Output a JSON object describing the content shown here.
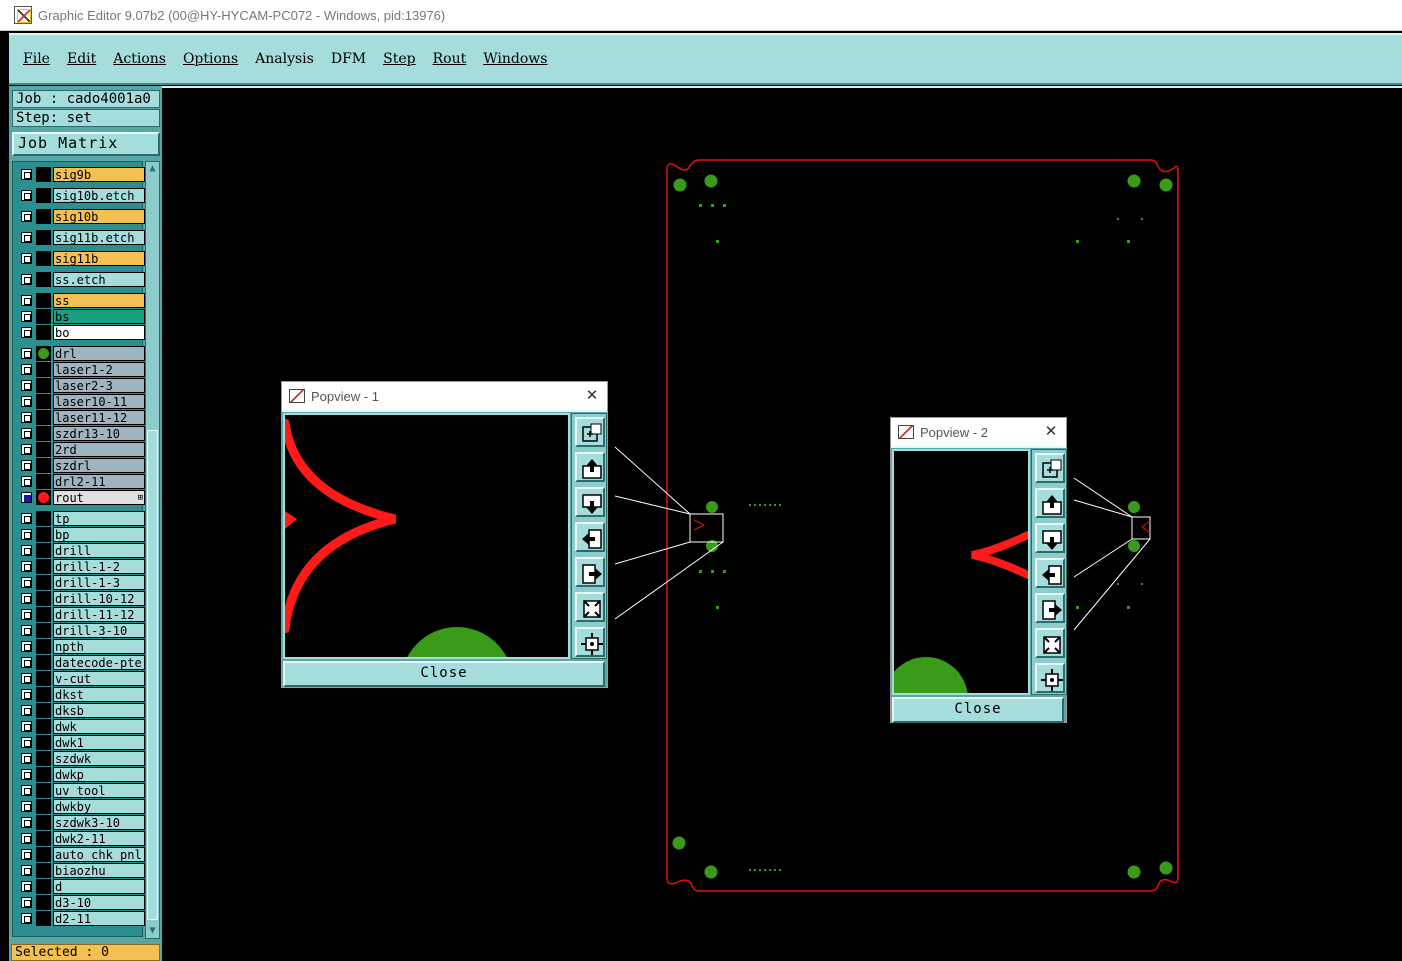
{
  "window": {
    "title": "Graphic Editor 9.07b2 (00@HY-HYCAM-PC072 - Windows, pid:13976)"
  },
  "menu": [
    {
      "label": "File",
      "underline": true
    },
    {
      "label": "Edit",
      "underline": true
    },
    {
      "label": "Actions",
      "underline": true
    },
    {
      "label": "Options",
      "underline": true
    },
    {
      "label": "Analysis",
      "underline": false
    },
    {
      "label": "DFM",
      "underline": false
    },
    {
      "label": "Step",
      "underline": true
    },
    {
      "label": "Rout",
      "underline": true
    },
    {
      "label": "Windows",
      "underline": true
    }
  ],
  "panel": {
    "job": "Job : cado4001a0",
    "step": "Step: set",
    "job_matrix": "Job Matrix ...",
    "selected": "Selected : 0"
  },
  "layers": [
    {
      "name": "sig9b",
      "color": "#f5c052"
    },
    {
      "name": "sig10b.etch",
      "color": "#a5dcdc"
    },
    {
      "name": "sig10b",
      "color": "#f5c052"
    },
    {
      "name": "sig11b.etch",
      "color": "#a5dcdc"
    },
    {
      "name": "sig11b",
      "color": "#f5c052"
    },
    {
      "name": "ss.etch",
      "color": "#a5dcdc"
    },
    {
      "name": "ss",
      "color": "#f5c052"
    },
    {
      "name": "bs",
      "color": "#18a080"
    },
    {
      "name": "bo",
      "color": "#ffffff"
    },
    {
      "name": "drl",
      "color": "#a0b4c0",
      "dot": "#3a9a1a"
    },
    {
      "name": "laser1-2",
      "color": "#a0b4c0"
    },
    {
      "name": "laser2-3",
      "color": "#a0b4c0"
    },
    {
      "name": "laser10-11",
      "color": "#a0b4c0"
    },
    {
      "name": "laser11-12",
      "color": "#a0b4c0"
    },
    {
      "name": "szdr13-10",
      "color": "#a0b4c0"
    },
    {
      "name": "2rd",
      "color": "#a0b4c0"
    },
    {
      "name": "szdrl",
      "color": "#a0b4c0"
    },
    {
      "name": "drl2-11",
      "color": "#a0b4c0"
    },
    {
      "name": "rout",
      "color": "#e0e0e0",
      "dot": "#ff1a1a",
      "checked": true,
      "plus": "⊞"
    },
    {
      "name": "tp",
      "color": "#a5dcdc"
    },
    {
      "name": "bp",
      "color": "#a5dcdc"
    },
    {
      "name": "drill",
      "color": "#a5dcdc"
    },
    {
      "name": "drill-1-2",
      "color": "#a5dcdc"
    },
    {
      "name": "drill-1-3",
      "color": "#a5dcdc"
    },
    {
      "name": "drill-10-12",
      "color": "#a5dcdc"
    },
    {
      "name": "drill-11-12",
      "color": "#a5dcdc"
    },
    {
      "name": "drill-3-10",
      "color": "#a5dcdc"
    },
    {
      "name": "npth",
      "color": "#a5dcdc"
    },
    {
      "name": "datecode-pte",
      "color": "#a5dcdc"
    },
    {
      "name": "v-cut",
      "color": "#a5dcdc"
    },
    {
      "name": "dkst",
      "color": "#a5dcdc"
    },
    {
      "name": "dksb",
      "color": "#a5dcdc"
    },
    {
      "name": "dwk",
      "color": "#a5dcdc"
    },
    {
      "name": "dwk1",
      "color": "#a5dcdc"
    },
    {
      "name": "szdwk",
      "color": "#a5dcdc"
    },
    {
      "name": "dwkp",
      "color": "#a5dcdc"
    },
    {
      "name": "uv_tool",
      "color": "#a5dcdc"
    },
    {
      "name": "dwkby",
      "color": "#a5dcdc"
    },
    {
      "name": "szdwk3-10",
      "color": "#a5dcdc"
    },
    {
      "name": "dwk2-11",
      "color": "#a5dcdc"
    },
    {
      "name": "auto_chk_pnl",
      "color": "#a5dcdc"
    },
    {
      "name": "biaozhu",
      "color": "#a5dcdc"
    },
    {
      "name": "d",
      "color": "#a5dcdc"
    },
    {
      "name": "d3-10",
      "color": "#a5dcdc"
    },
    {
      "name": "d2-11",
      "color": "#a5dcdc"
    }
  ],
  "popview1": {
    "title": "Popview - 1",
    "close_label": "Close",
    "close_x": "✕"
  },
  "popview2": {
    "title": "Popview - 2",
    "close_label": "Close",
    "close_x": "✕"
  },
  "colors": {
    "menu_bg": "#a5dcdc",
    "panel_bg": "#5aa6a6",
    "rout": "#ff1a1a",
    "pad": "#3a9a1a",
    "canvas_bg": "#000000"
  }
}
